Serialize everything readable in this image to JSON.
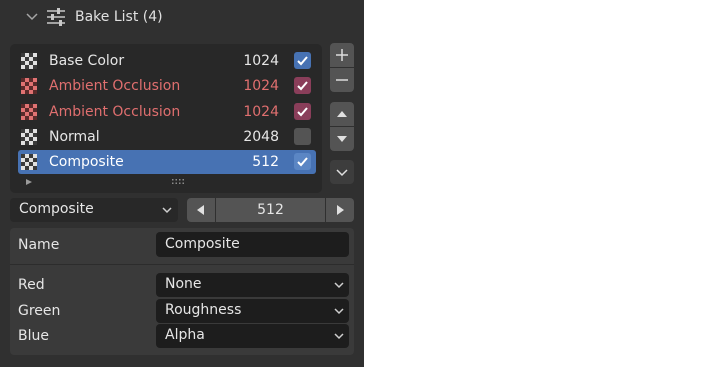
{
  "header": {
    "title": "Bake List (4)",
    "collapse_icon": "chevron-down-icon",
    "settings_icon": "sliders-icon"
  },
  "bake_list": {
    "items": [
      {
        "name": "Base Color",
        "resolution": "1024",
        "checked": true,
        "warning": false
      },
      {
        "name": "Ambient Occlusion",
        "resolution": "1024",
        "checked": true,
        "warning": true
      },
      {
        "name": "Ambient Occlusion",
        "resolution": "1024",
        "checked": true,
        "warning": true
      },
      {
        "name": "Normal",
        "resolution": "2048",
        "checked": false,
        "warning": false
      },
      {
        "name": "Composite",
        "resolution": "512",
        "checked": true,
        "warning": false,
        "selected": true
      }
    ],
    "expand_icon": "triangle-right-icon",
    "resize_handle_icon": "grip-dots-icon"
  },
  "side_buttons": {
    "add_icon": "plus-icon",
    "remove_icon": "minus-icon",
    "move_up_icon": "triangle-up-icon",
    "move_down_icon": "triangle-down-icon",
    "specials_icon": "chevron-down-icon"
  },
  "type_select": {
    "value": "Composite"
  },
  "resolution_stepper": {
    "value": "512"
  },
  "properties": {
    "name_label": "Name",
    "name_value": "Composite",
    "channels": [
      {
        "label": "Red",
        "value": "None"
      },
      {
        "label": "Green",
        "value": "Roughness"
      },
      {
        "label": "Blue",
        "value": "Alpha"
      }
    ]
  },
  "colors": {
    "panel_bg": "#303030",
    "selection": "#4772b3",
    "warning_text": "#e06f6f",
    "warning_check": "#8a3e5a"
  }
}
